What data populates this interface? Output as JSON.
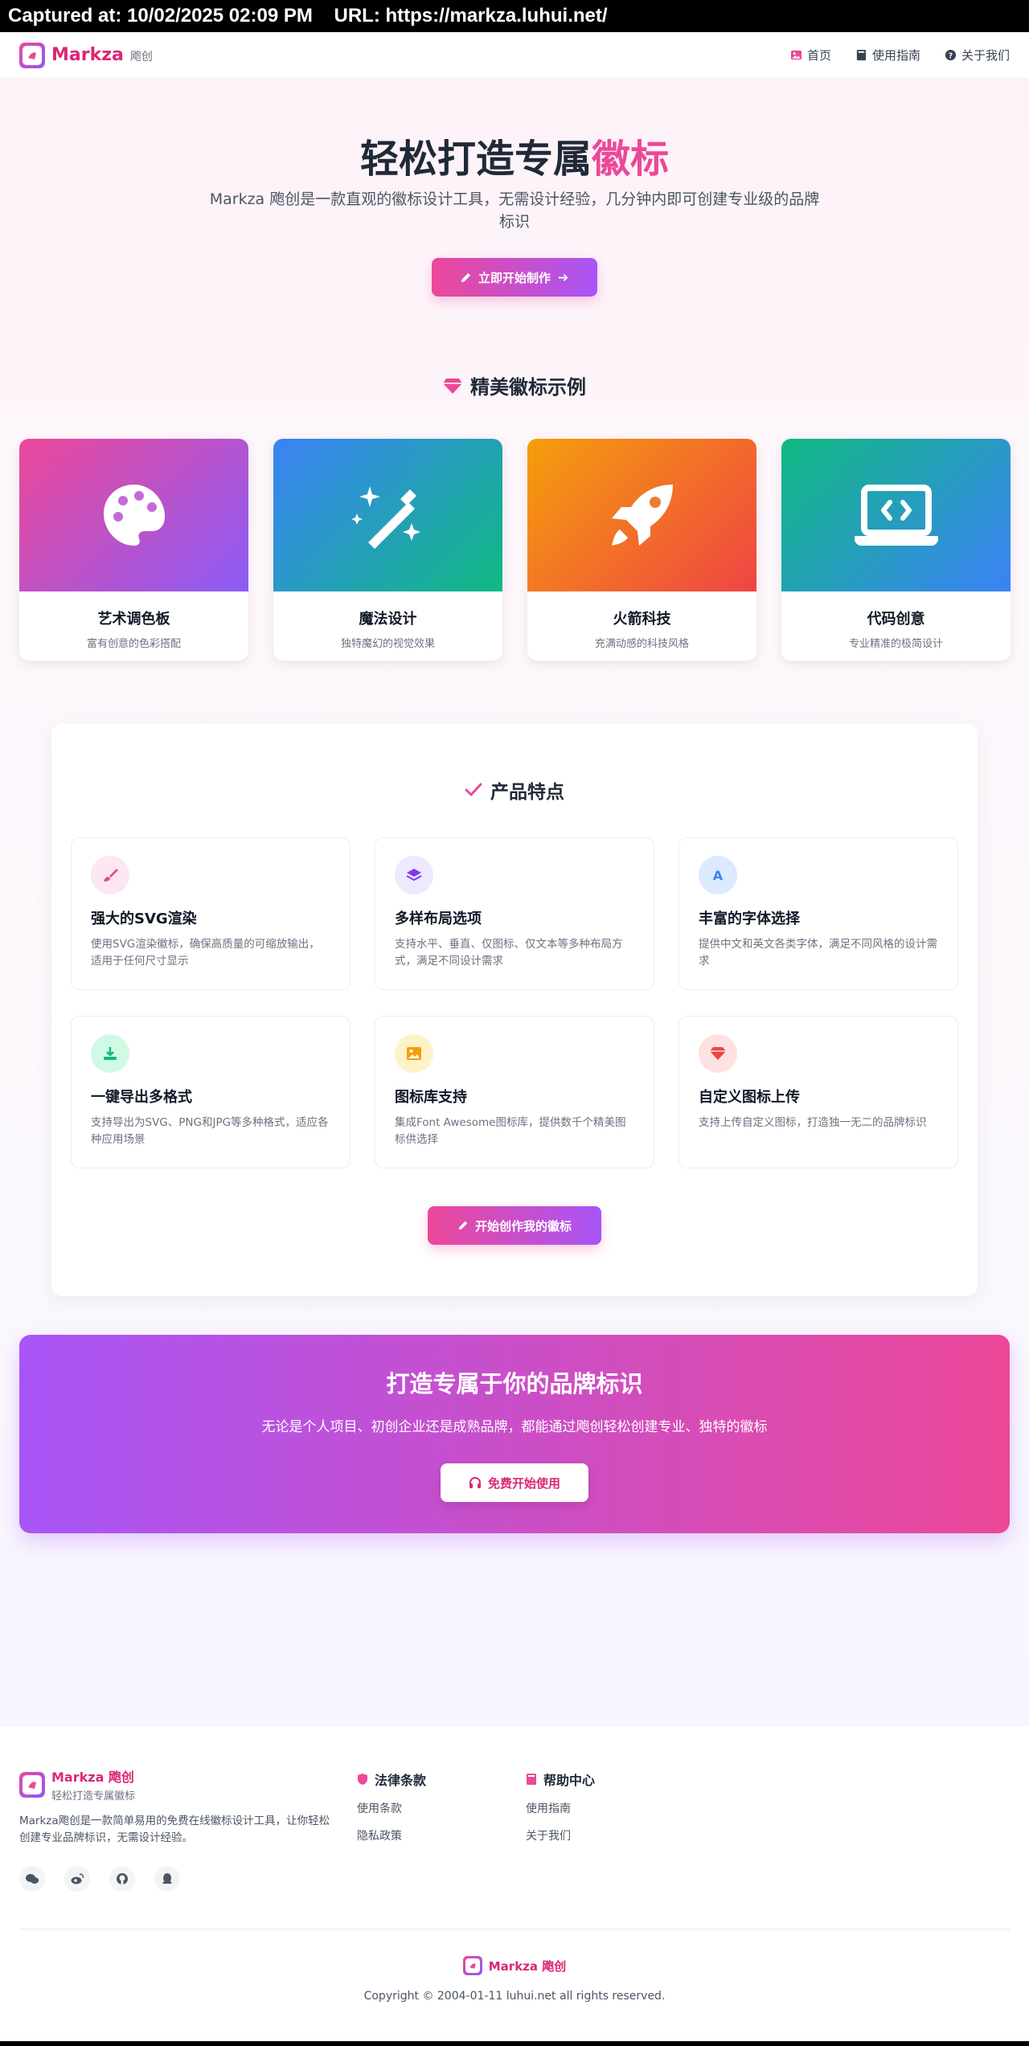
{
  "capture": {
    "text": "Captured at: 10/02/2025 02:09 PM    URL: https://markza.luhui.net/"
  },
  "nav": {
    "brand_name": "Markza",
    "brand_sub": "飑创",
    "links": [
      {
        "label": "首页",
        "icon": "image-icon"
      },
      {
        "label": "使用指南",
        "icon": "book-icon"
      },
      {
        "label": "关于我们",
        "icon": "question-circle-icon"
      }
    ]
  },
  "hero": {
    "title_main": "轻松打造专属",
    "title_highlight": "徽标",
    "description": "Markza 飑创是一款直观的徽标设计工具，无需设计经验，几分钟内即可创建专业级的品牌标识",
    "cta_label": "立即开始制作"
  },
  "examples": {
    "title": "精美徽标示例",
    "cards": [
      {
        "title": "艺术调色板",
        "subtitle": "富有创意的色彩搭配",
        "icon": "palette-icon"
      },
      {
        "title": "魔法设计",
        "subtitle": "独特魔幻的视觉效果",
        "icon": "magic-wand-icon"
      },
      {
        "title": "火箭科技",
        "subtitle": "充满动感的科技风格",
        "icon": "rocket-icon"
      },
      {
        "title": "代码创意",
        "subtitle": "专业精准的极简设计",
        "icon": "laptop-code-icon"
      }
    ]
  },
  "features": {
    "title": "产品特点",
    "items": [
      {
        "name": "强大的SVG渲染",
        "desc": "使用SVG渲染徽标，确保高质量的可缩放输出，适用于任何尺寸显示",
        "icon": "brush-icon"
      },
      {
        "name": "多样布局选项",
        "desc": "支持水平、垂直、仅图标、仅文本等多种布局方式，满足不同设计需求",
        "icon": "layers-icon"
      },
      {
        "name": "丰富的字体选择",
        "desc": "提供中文和英文各类字体，满足不同风格的设计需求",
        "icon": "font-icon"
      },
      {
        "name": "一键导出多格式",
        "desc": "支持导出为SVG、PNG和JPG等多种格式，适应各种应用场景",
        "icon": "download-icon"
      },
      {
        "name": "图标库支持",
        "desc": "集成Font Awesome图标库，提供数千个精美图标供选择",
        "icon": "image-icon"
      },
      {
        "name": "自定义图标上传",
        "desc": "支持上传自定义图标，打造独一无二的品牌标识",
        "icon": "gem-icon"
      }
    ],
    "cta_label": "开始创作我的徽标"
  },
  "cta": {
    "title": "打造专属于你的品牌标识",
    "description": "无论是个人项目、初创企业还是成熟品牌，都能通过飑创轻松创建专业、独特的徽标",
    "button_label": "免费开始使用"
  },
  "footer": {
    "brand_name": "Markza 飑创",
    "brand_tag": "轻松打造专属徽标",
    "description": "Markza飑创是一款简单易用的免费在线徽标设计工具，让你轻松创建专业品牌标识，无需设计经验。",
    "social": [
      "wechat-icon",
      "weibo-icon",
      "github-icon",
      "qq-icon"
    ],
    "legal": {
      "title": "法律条款",
      "links": [
        "使用条款",
        "隐私政策"
      ]
    },
    "help": {
      "title": "帮助中心",
      "links": [
        "使用指南",
        "关于我们"
      ]
    },
    "mini_brand": "Markza 飑创",
    "copyright": "Copyright © 2004-01-11 luhui.net all rights reserved."
  }
}
